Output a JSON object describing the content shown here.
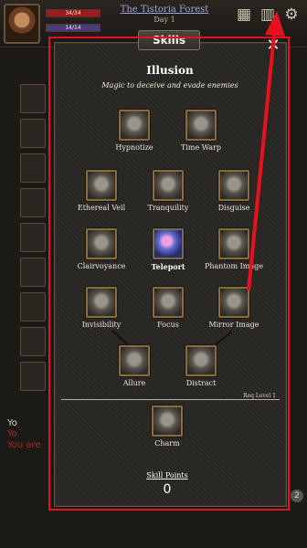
{
  "hud": {
    "health_text": "34/34",
    "health_fraction": 1.0,
    "mana_text": "14/14",
    "mana_fraction": 1.0,
    "location": "The Tistoria Forest",
    "day": "Day 1",
    "page_badge": "2"
  },
  "log": {
    "line1": "Yo",
    "line2": "Yo",
    "line3": "You are"
  },
  "panel": {
    "title": "Skills",
    "close_glyph": "✕",
    "school_name": "Illusion",
    "school_description": "Magic to deceive and evade enemies",
    "req_level_text": "Req Level 1",
    "skill_points_label": "Skill Points",
    "skill_points_value": "0"
  },
  "skills": {
    "hypnotize": "Hypnotize",
    "time_warp": "Time Warp",
    "ethereal_veil": "Ethereal Veil",
    "tranquility": "Tranquility",
    "disguise": "Disguise",
    "clairvoyance": "Clairvoyance",
    "teleport": "Teleport",
    "phantom_image": "Phantom Image",
    "invisibility": "Invisibility",
    "focus": "Focus",
    "mirror_image": "Mirror Image",
    "allure": "Allure",
    "distract": "Distract",
    "charm": "Charm"
  },
  "colors": {
    "annotation_red": "#e8101e",
    "panel_bg": "#292724",
    "icon_frame": "#8b6a3c"
  },
  "icons": {
    "close": "close-icon",
    "inventory": "bag-icon",
    "spellbook": "book-icon",
    "settings": "gear-icon"
  }
}
